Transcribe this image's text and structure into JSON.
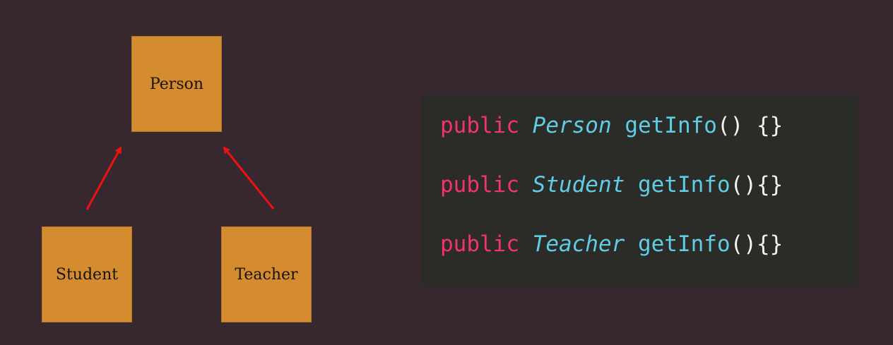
{
  "diagram": {
    "parent_class": "Person",
    "children": [
      "Student",
      "Teacher"
    ],
    "arrow_color": "#ee1111",
    "box_color": "#d48c2e"
  },
  "code": {
    "lines": [
      {
        "keyword": "public",
        "type": "Person",
        "method": "getInfo",
        "parens": "()",
        "gap": " ",
        "braces": "{}"
      },
      {
        "keyword": "public",
        "type": "Student",
        "method": "getInfo",
        "parens": "()",
        "gap": "",
        "braces": "{}"
      },
      {
        "keyword": "public",
        "type": "Teacher",
        "method": "getInfo",
        "parens": "()",
        "gap": "",
        "braces": "{}"
      }
    ],
    "colors": {
      "keyword": "#f2336f",
      "type": "#5fcde4",
      "method": "#5fcde4",
      "punctuation": "#f4f4ef",
      "background": "#2b2b27"
    }
  }
}
